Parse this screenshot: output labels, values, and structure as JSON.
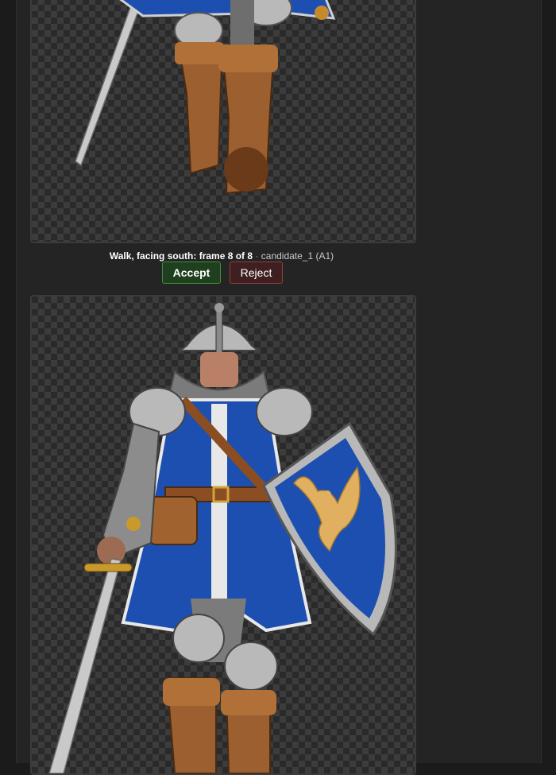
{
  "frame_caption": {
    "title": "Walk, facing south: frame 8 of 8",
    "separator": "·",
    "candidate": "candidate_1 (A1)"
  },
  "actions": {
    "accept_label": "Accept",
    "reject_label": "Reject"
  },
  "colors": {
    "accept_border": "#3f8f3f",
    "reject_border": "#8f3f3f",
    "tabard_blue": "#1d4fb0",
    "emblem_gold": "#e0b060"
  },
  "sprites": [
    {
      "icon": "knight-walk-sprite-partial"
    },
    {
      "icon": "knight-walk-sprite-full"
    }
  ]
}
